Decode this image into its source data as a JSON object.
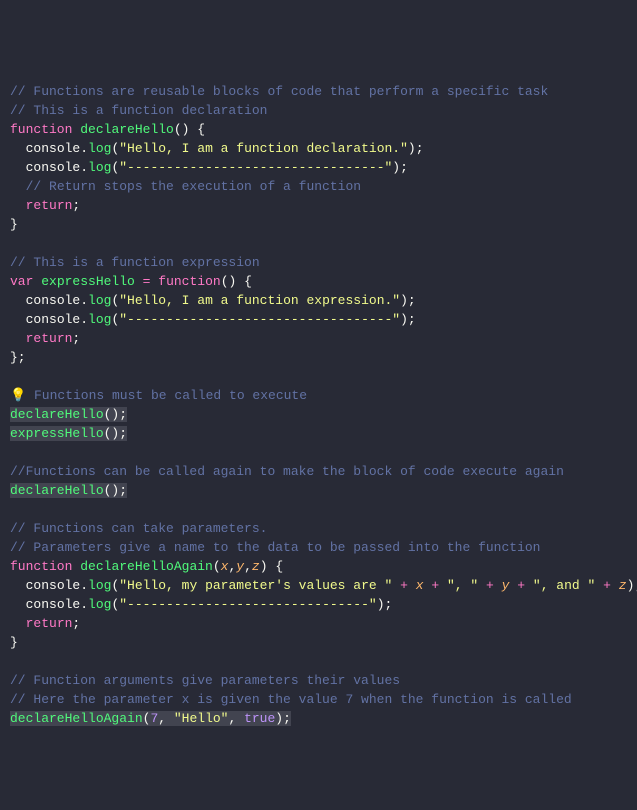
{
  "c": {
    "line1": "// Functions are reusable blocks of code that perform a specific task",
    "line2": "// This is a function declaration",
    "retcomment": "// Return stops the execution of a function",
    "expr": "// This is a function expression",
    "mustcall": " Functions must be called to execute",
    "again": "//Functions can be called again to make the block of code execute again",
    "params1": "// Functions can take parameters.",
    "params2": "// Parameters give a name to the data to be passed into the function",
    "args1": "// Function arguments give parameters their values",
    "args2": "// Here the parameter x is given the value 7 when the function is called"
  },
  "kw": {
    "function": "function",
    "var": "var",
    "return": "return"
  },
  "fn": {
    "declareHello": "declareHello",
    "expressHello": "expressHello",
    "declareHelloAgain": "declareHelloAgain"
  },
  "obj": {
    "console": "console"
  },
  "mth": {
    "log": "log"
  },
  "str": {
    "decl": "\"Hello, I am a function declaration.\"",
    "dash1": "\"---------------------------------\"",
    "expr": "\"Hello, I am a function expression.\"",
    "dash2": "\"----------------------------------\"",
    "paramMsg": "\"Hello, my parameter's values are \"",
    "comma": "\", \"",
    "and": "\", and \"",
    "dash3": "\"-------------------------------\"",
    "helloArg": "\"Hello\""
  },
  "prm": {
    "x": "x",
    "y": "y",
    "z": "z"
  },
  "num": {
    "seven": "7"
  },
  "bool": {
    "true": "true"
  },
  "icon": {
    "bulb": "💡"
  }
}
